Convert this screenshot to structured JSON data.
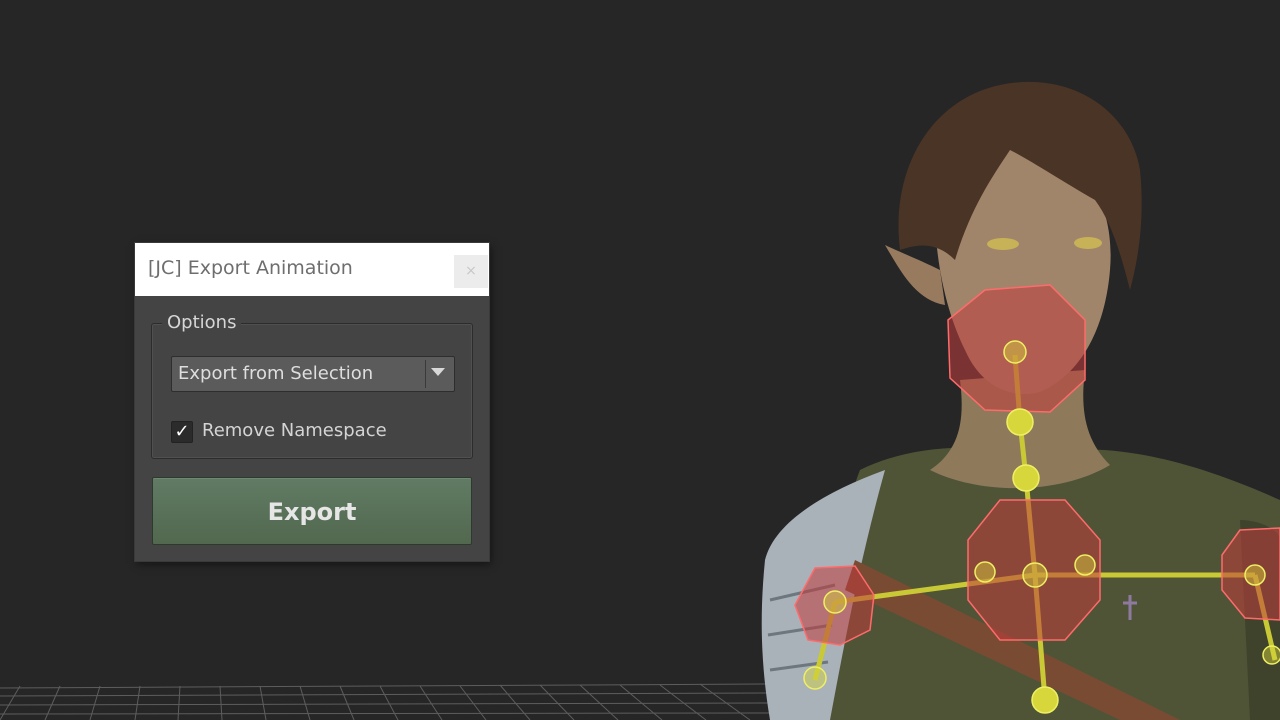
{
  "dialog": {
    "title": "[JC] Export Animation",
    "close_glyph": "×",
    "options_group_label": "Options",
    "export_mode": {
      "selected": "Export from Selection"
    },
    "remove_namespace": {
      "label": "Remove Namespace",
      "checked": true,
      "check_glyph": "✓"
    },
    "export_button_label": "Export"
  },
  "colors": {
    "viewport_background": "#262626",
    "dialog_background": "#444444",
    "titlebar_background": "#ffffff",
    "export_button": "#5a725c",
    "joint_wire": "#c9c936",
    "control_shape": "#d44a4a"
  },
  "icons": {
    "close": "close-icon",
    "dropdown": "chevron-down-icon",
    "checkbox": "checkmark-icon"
  }
}
